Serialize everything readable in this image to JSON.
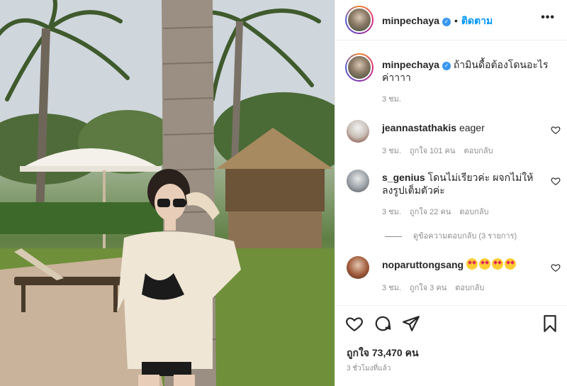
{
  "post": {
    "username": "minpechaya",
    "follow_label": "ติดตาม",
    "dot": "•",
    "more": "•••",
    "caption": "ถ้ามินดื้อต้องโดนอะไร ค่าาาา",
    "caption_time": "3 ชม."
  },
  "comments": [
    {
      "user": "jeannastathakis",
      "text": "eager",
      "time": "3 ชม.",
      "likes": "ถูกใจ 101 คน",
      "reply": "ตอบกลับ"
    },
    {
      "user": "s_genius",
      "text": "โดนไม่เรียวค่ะ ผจกไม่ให้ลงรูปเต็มตัวค่ะ",
      "time": "3 ชม.",
      "likes": "ถูกใจ 22 คน",
      "reply": "ตอบกลับ"
    },
    {
      "user": "noparuttongsang",
      "text": "",
      "time": "3 ชม.",
      "likes": "ถูกใจ 3 คน",
      "reply": "ตอบกลับ"
    }
  ],
  "view_replies": "ดูข้อความตอบกลับ (3 รายการ)",
  "footer": {
    "likes": "ถูกใจ 73,470 คน",
    "ago": "3 ชั่วโมงที่แล้ว"
  },
  "icons": {
    "verified": "verified-badge-icon",
    "heart": "heart-icon",
    "comment": "comment-icon",
    "share": "share-icon",
    "save": "bookmark-icon"
  },
  "colors": {
    "link": "#0095f6",
    "muted": "#8e8e8e",
    "verified": "#3897f0"
  }
}
